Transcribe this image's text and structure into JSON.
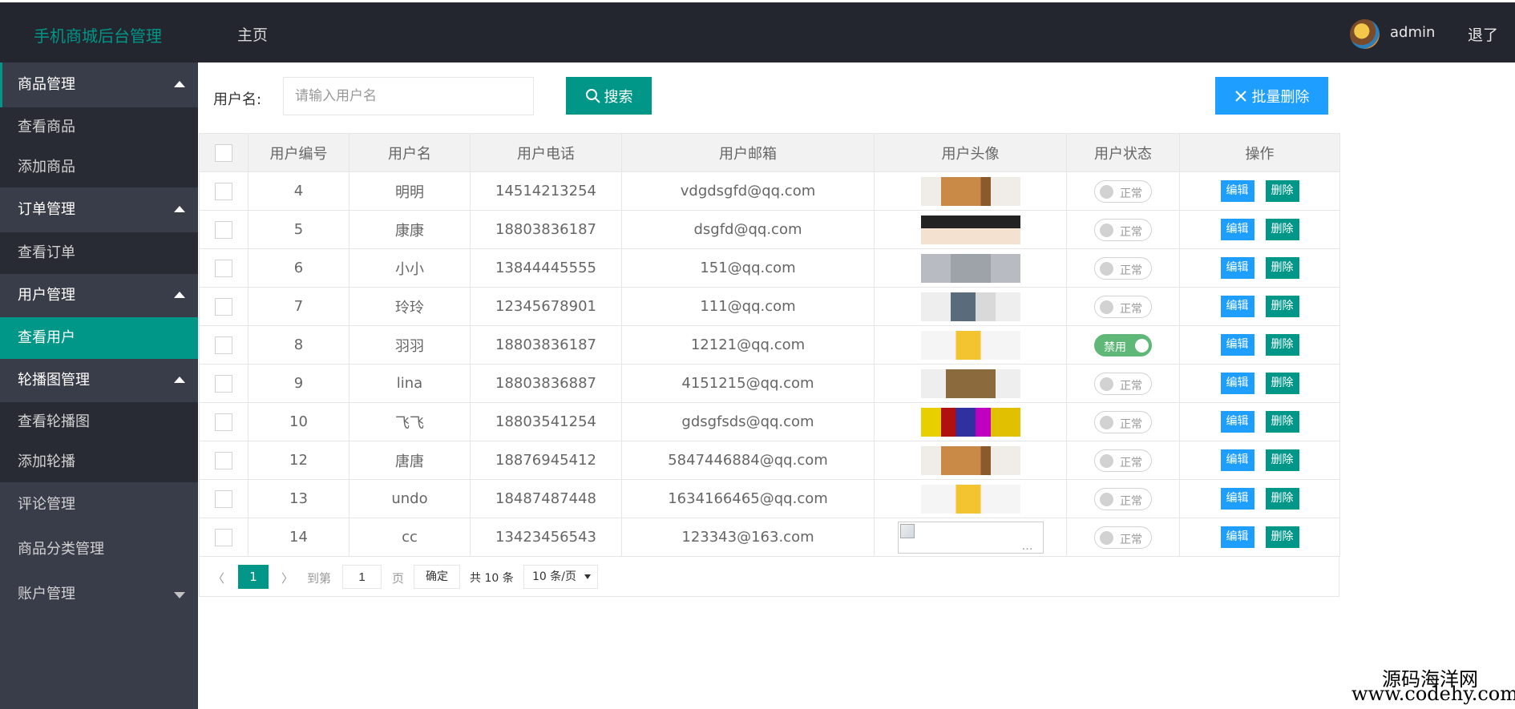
{
  "header": {
    "logo": "手机商城后台管理",
    "home": "主页",
    "username": "admin",
    "logout": "退了"
  },
  "sidebar": {
    "groups": [
      {
        "label": "商品管理",
        "items": [
          "查看商品",
          "添加商品"
        ]
      },
      {
        "label": "订单管理",
        "items": [
          "查看订单"
        ]
      },
      {
        "label": "用户管理",
        "items": [
          "查看用户"
        ]
      },
      {
        "label": "轮播图管理",
        "items": [
          "查看轮播图",
          "添加轮播"
        ]
      },
      {
        "label": "评论管理"
      },
      {
        "label": "商品分类管理"
      },
      {
        "label": "账户管理"
      }
    ],
    "active_item": "查看用户"
  },
  "search": {
    "label": "用户名:",
    "placeholder": "请输入用户名",
    "button": "搜索",
    "bulk_delete": "批量删除"
  },
  "table": {
    "headers": [
      "用户编号",
      "用户名",
      "用户电话",
      "用户邮箱",
      "用户头像",
      "用户状态",
      "操作"
    ],
    "edit_label": "编辑",
    "delete_label": "删除",
    "rows": [
      {
        "id": "4",
        "name": "明明",
        "phone": "14514213254",
        "email": "vdgdsgfd@qq.com",
        "avatar": "dog",
        "status": "正常",
        "on": false
      },
      {
        "id": "5",
        "name": "康康",
        "phone": "18803836187",
        "email": "dsgfd@qq.com",
        "avatar": "boy",
        "status": "正常",
        "on": false
      },
      {
        "id": "6",
        "name": "小小",
        "phone": "13844445555",
        "email": "151@qq.com",
        "avatar": "koala",
        "status": "正常",
        "on": false
      },
      {
        "id": "7",
        "name": "玲玲",
        "phone": "12345678901",
        "email": "111@qq.com",
        "avatar": "cat",
        "status": "正常",
        "on": false
      },
      {
        "id": "8",
        "name": "羽羽",
        "phone": "18803836187",
        "email": "12121@qq.com",
        "avatar": "chick",
        "status": "禁用",
        "on": true
      },
      {
        "id": "9",
        "name": "lina",
        "phone": "18803836887",
        "email": "4151215@qq.com",
        "avatar": "owl",
        "status": "正常",
        "on": false
      },
      {
        "id": "10",
        "name": "飞飞",
        "phone": "18803541254",
        "email": "gdsgfsds@qq.com",
        "avatar": "colorful",
        "status": "正常",
        "on": false
      },
      {
        "id": "12",
        "name": "唐唐",
        "phone": "18876945412",
        "email": "5847446884@qq.com",
        "avatar": "dog",
        "status": "正常",
        "on": false
      },
      {
        "id": "13",
        "name": "undo",
        "phone": "18487487448",
        "email": "1634166465@qq.com",
        "avatar": "chick",
        "status": "正常",
        "on": false
      },
      {
        "id": "14",
        "name": "cc",
        "phone": "13423456543",
        "email": "123343@163.com",
        "avatar": "broken",
        "status": "正常",
        "on": false
      }
    ]
  },
  "pagination": {
    "prev": "〈",
    "current": "1",
    "next": "〉",
    "goto_label": "到第",
    "goto_value": "1",
    "page_unit": "页",
    "confirm": "确定",
    "total": "共 10 条",
    "page_size": "10 条/页"
  },
  "watermark": {
    "line1": "源码海洋网",
    "line2": "www.codehy.com"
  },
  "colors": {
    "accent": "#009688",
    "blue": "#1e9fff",
    "header_bg": "#23262e",
    "sidebar_bg": "#393d49"
  }
}
